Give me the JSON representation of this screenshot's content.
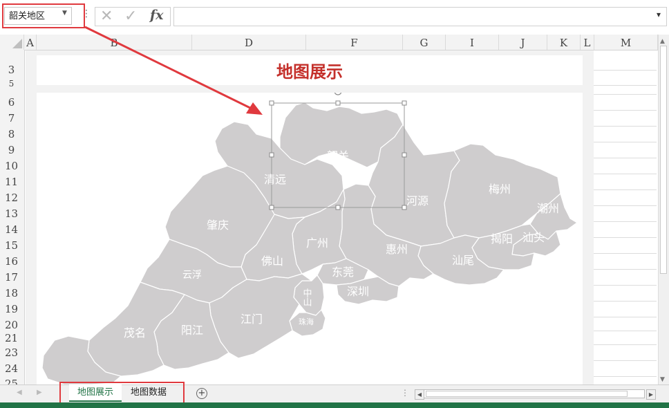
{
  "formula_bar": {
    "name_box": "韶关地区",
    "cancel_icon": "✕",
    "enter_icon": "✓",
    "fx_label": "fx",
    "formula_value": ""
  },
  "columns": [
    "A",
    "B",
    "D",
    "F",
    "G",
    "I",
    "J",
    "K",
    "L",
    "M"
  ],
  "rows": [
    "3",
    "5",
    "6",
    "7",
    "8",
    "9",
    "10",
    "11",
    "12",
    "13",
    "14",
    "15",
    "16",
    "17",
    "18",
    "19",
    "20",
    "21",
    "23",
    "24",
    "25"
  ],
  "chart": {
    "title": "地图展示",
    "selected_region": "韶关",
    "regions": [
      "韶关",
      "清远",
      "河源",
      "梅州",
      "潮州",
      "肇庆",
      "广州",
      "惠州",
      "揭阳",
      "汕头",
      "佛山",
      "云浮",
      "汕尾",
      "东莞",
      "深圳",
      "中山",
      "珠海",
      "江门",
      "阳江",
      "茂名"
    ],
    "fill_color": "#cfcdce",
    "border_color": "#ffffff",
    "title_color": "#c4302b"
  },
  "annotation": {
    "highlight_color": "#e0393e"
  },
  "sheet_tabs": {
    "tabs": [
      "地图展示",
      "地图数据"
    ],
    "active": "地图展示",
    "add_icon": "plus-circle-icon"
  }
}
